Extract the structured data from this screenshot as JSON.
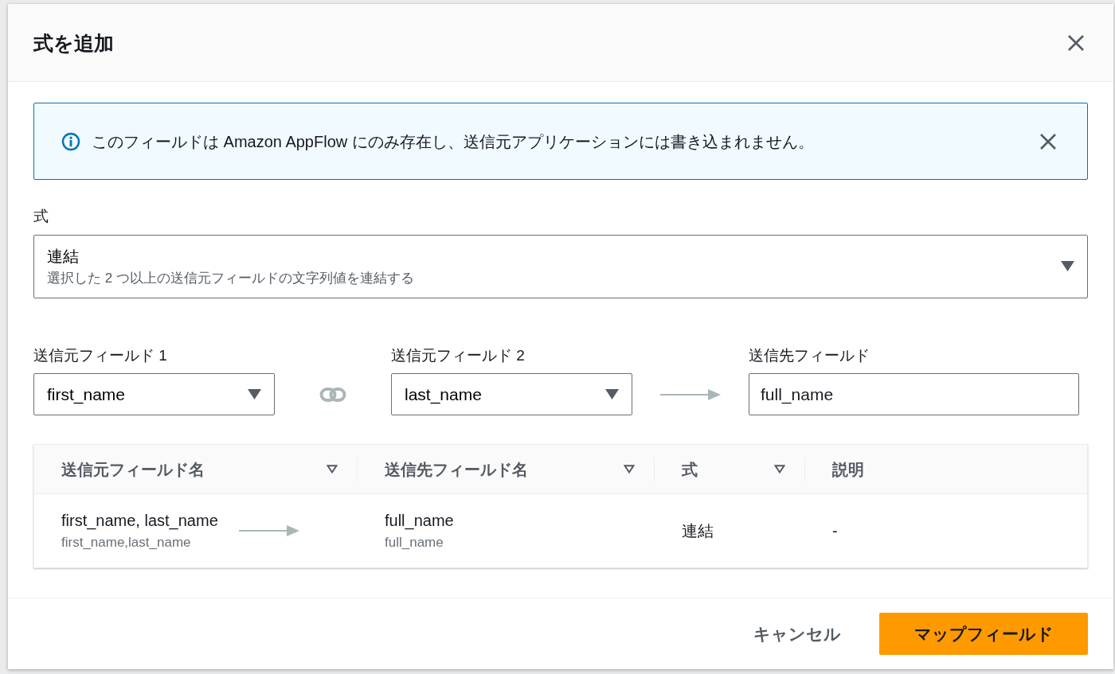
{
  "dialog": {
    "title": "式を追加"
  },
  "alert": {
    "text": "このフィールドは Amazon AppFlow にのみ存在し、送信元アプリケーションには書き込まれません。"
  },
  "expression": {
    "label": "式",
    "value": "連結",
    "description": "選択した 2 つ以上の送信元フィールドの文字列値を連結する"
  },
  "source_field_1": {
    "label": "送信元フィールド 1",
    "value": "first_name"
  },
  "source_field_2": {
    "label": "送信元フィールド 2",
    "value": "last_name"
  },
  "destination_field": {
    "label": "送信先フィールド",
    "value": "full_name"
  },
  "table": {
    "columns": [
      {
        "label": "送信元フィールド名",
        "sortable": true
      },
      {
        "label": "送信先フィールド名",
        "sortable": true
      },
      {
        "label": "式",
        "sortable": true
      },
      {
        "label": "説明",
        "sortable": false
      }
    ],
    "rows": [
      {
        "source": "first_name, last_name",
        "source_detail": "first_name,last_name",
        "destination": "full_name",
        "destination_detail": "full_name",
        "expression": "連結",
        "description": "-"
      }
    ]
  },
  "footer": {
    "buttons": [
      {
        "label": "キャンセル",
        "kind": "link"
      },
      {
        "label": "マップフィールド",
        "kind": "primary"
      }
    ]
  }
}
